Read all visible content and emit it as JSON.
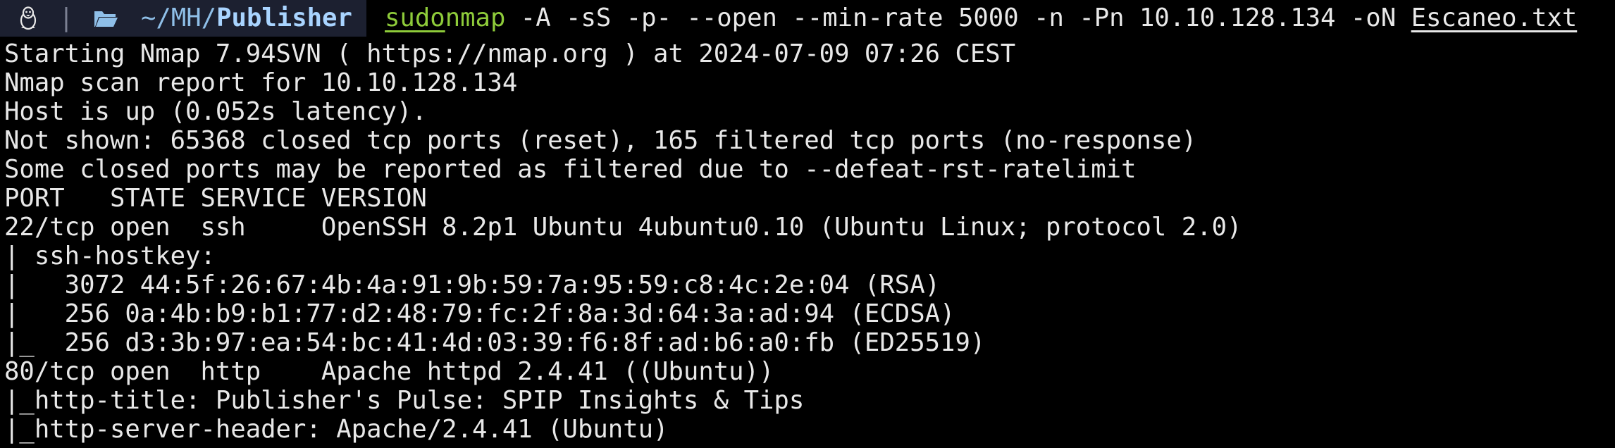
{
  "prompt": {
    "tux_icon": "tux-icon",
    "separator": "|",
    "folder_icon": "folder-icon",
    "path_prefix": "~/MH/",
    "path_current": "Publisher"
  },
  "command": {
    "sudo": "sudo",
    "program": "nmap",
    "args": " -A -sS -p- --open --min-rate 5000 -n -Pn 10.10.128.134 -oN ",
    "output_file": "Escaneo.txt"
  },
  "output_lines": [
    "Starting Nmap 7.94SVN ( https://nmap.org ) at 2024-07-09 07:26 CEST",
    "Nmap scan report for 10.10.128.134",
    "Host is up (0.052s latency).",
    "Not shown: 65368 closed tcp ports (reset), 165 filtered tcp ports (no-response)",
    "Some closed ports may be reported as filtered due to --defeat-rst-ratelimit",
    "PORT   STATE SERVICE VERSION",
    "22/tcp open  ssh     OpenSSH 8.2p1 Ubuntu 4ubuntu0.10 (Ubuntu Linux; protocol 2.0)",
    "| ssh-hostkey: ",
    "|   3072 44:5f:26:67:4b:4a:91:9b:59:7a:95:59:c8:4c:2e:04 (RSA)",
    "|   256 0a:4b:b9:b1:77:d2:48:79:fc:2f:8a:3d:64:3a:ad:94 (ECDSA)",
    "|_  256 d3:3b:97:ea:54:bc:41:4d:03:39:f6:8f:ad:b6:a0:fb (ED25519)",
    "80/tcp open  http    Apache httpd 2.4.41 ((Ubuntu))",
    "|_http-title: Publisher's Pulse: SPIP Insights & Tips",
    "|_http-server-header: Apache/2.4.41 (Ubuntu)"
  ],
  "colors": {
    "background": "#000000",
    "prompt_bg": "#1c2030",
    "command_green": "#8ecb3a",
    "path_blue": "#8fbfe8",
    "text": "#e8e8e8"
  }
}
